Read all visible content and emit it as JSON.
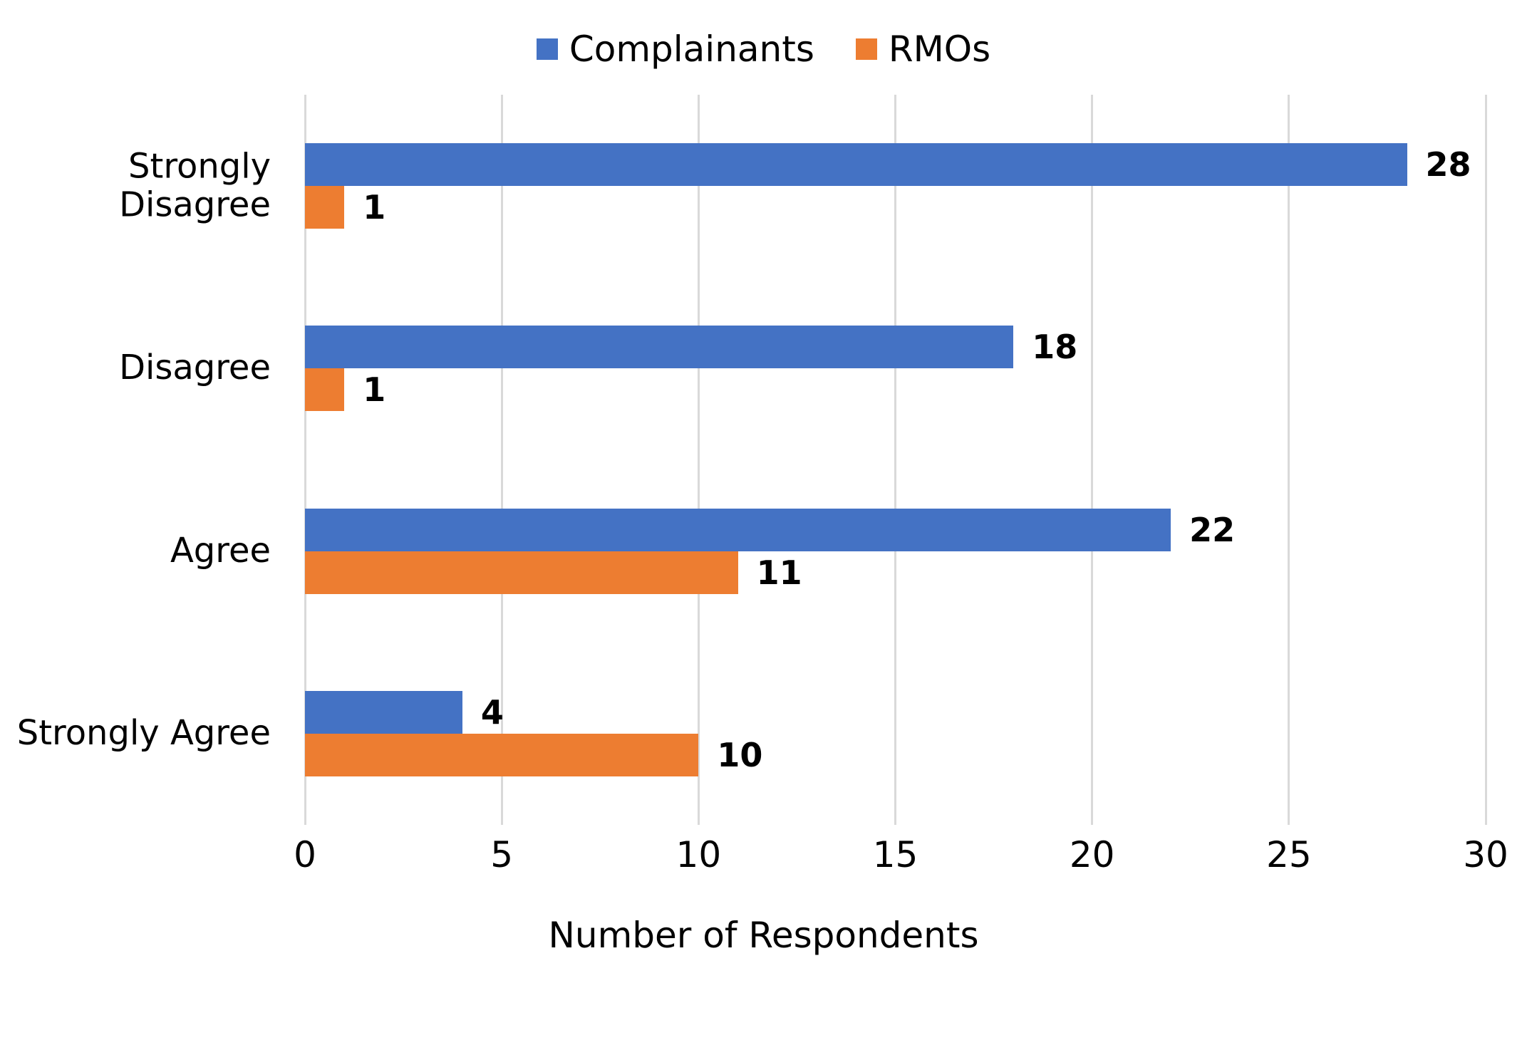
{
  "chart_data": {
    "type": "bar",
    "orientation": "horizontal",
    "title": "",
    "subtitle": "",
    "xlabel": "Number of Respondents",
    "ylabel": "",
    "xlim": [
      0,
      30
    ],
    "xticks": [
      0,
      5,
      10,
      15,
      20,
      25,
      30
    ],
    "xtick_labels": [
      "0",
      "5",
      "10",
      "15",
      "20",
      "25",
      "30"
    ],
    "grid": "vertical",
    "legend_position": "top-center",
    "categories": [
      "Strongly Disagree",
      "Disagree",
      "Agree",
      "Strongly Agree"
    ],
    "category_label_lines": [
      [
        "Strongly",
        "Disagree"
      ],
      [
        "Disagree"
      ],
      [
        "Agree"
      ],
      [
        "Strongly Agree"
      ]
    ],
    "series": [
      {
        "name": "Complainants",
        "color": "#4472C4",
        "values": [
          28,
          18,
          22,
          4
        ],
        "value_labels": [
          "28",
          "18",
          "22",
          "4"
        ]
      },
      {
        "name": "RMOs",
        "color": "#ED7D31",
        "values": [
          1,
          1,
          11,
          10
        ],
        "value_labels": [
          "1",
          "1",
          "11",
          "10"
        ]
      }
    ]
  },
  "legend": {
    "items": [
      {
        "label": "Complainants",
        "color": "#4472C4",
        "swatch": "square-marker"
      },
      {
        "label": "RMOs",
        "color": "#ED7D31",
        "swatch": "square-marker"
      }
    ]
  },
  "axes": {
    "x_title": "Number of Respondents",
    "x_tick_labels": [
      "0",
      "5",
      "10",
      "15",
      "20",
      "25",
      "30"
    ],
    "gridline_color": "#D9D9D9"
  },
  "colors": {
    "complainants": "#4472C4",
    "rmos": "#ED7D31",
    "gridline": "#D9D9D9",
    "text": "#000000",
    "background": "#FFFFFF"
  }
}
